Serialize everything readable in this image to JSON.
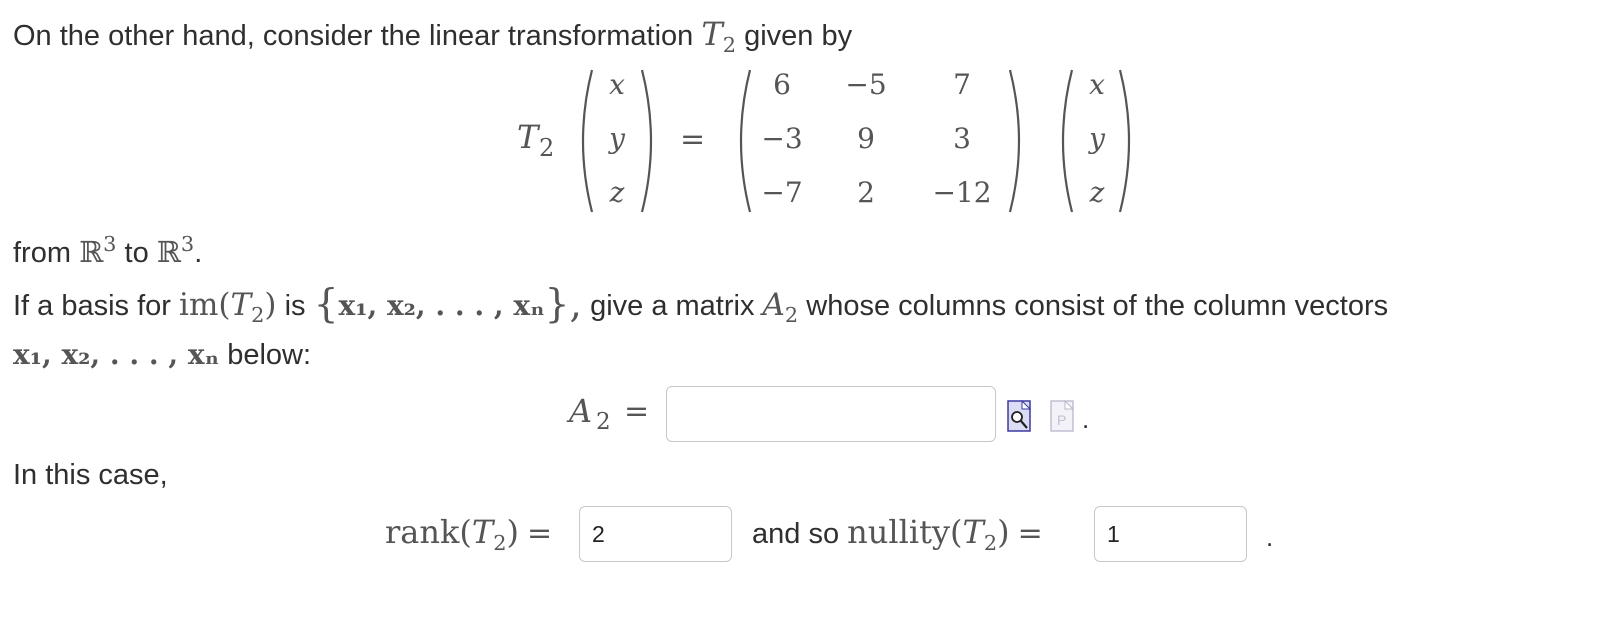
{
  "intro": {
    "text": "On the other hand, consider the linear transformation",
    "T": "T",
    "T_sub": "2",
    "suffix": "given by"
  },
  "equation": {
    "T": "T",
    "T_sub": "2",
    "input_vector": [
      "x",
      "y",
      "z"
    ],
    "equals": "=",
    "matrix": [
      [
        "6",
        "−5",
        "7"
      ],
      [
        "−3",
        "9",
        "3"
      ],
      [
        "−7",
        "2",
        "−12"
      ]
    ],
    "output_vector": [
      "x",
      "y",
      "z"
    ]
  },
  "from_line": {
    "from": "from",
    "R1": "ℝ",
    "exp1": "3",
    "to": "to",
    "R2": "ℝ",
    "exp2": "3",
    "period": "."
  },
  "basis_line": {
    "prefix": "If a basis for",
    "im": "im(",
    "T": "T",
    "T_sub": "2",
    "close": ")",
    "is": "is",
    "set_open": "{",
    "set_content": "x₁, x₂, . . . , xₙ",
    "set_close": "},",
    "give": "give a matrix",
    "A": "A",
    "A_sub": "2",
    "rest": "whose columns consist of the column vectors"
  },
  "vectors_line": {
    "vectors": "x₁, x₂, . . . , xₙ",
    "below": "below:"
  },
  "a2_answer": {
    "label_A": "A",
    "label_sub": "2",
    "equals": "=",
    "value": "",
    "trailing": "."
  },
  "case_text": "In this case,",
  "rank": {
    "label": "rank(",
    "T": "T",
    "T_sub": "2",
    "close": ")",
    "equals": "=",
    "value": "2"
  },
  "nullity": {
    "and_so": "and so",
    "label": "nullity(",
    "T": "T",
    "T_sub": "2",
    "close": ")",
    "equals": "=",
    "value": "1",
    "trailing": "."
  },
  "icons": [
    "matrix-preview-icon",
    "paste-icon"
  ],
  "colors": {
    "text": "#2f2f2f",
    "math": "#555555",
    "input_border": "#c8c8c8",
    "icon_blue": "#4a4ab8"
  }
}
